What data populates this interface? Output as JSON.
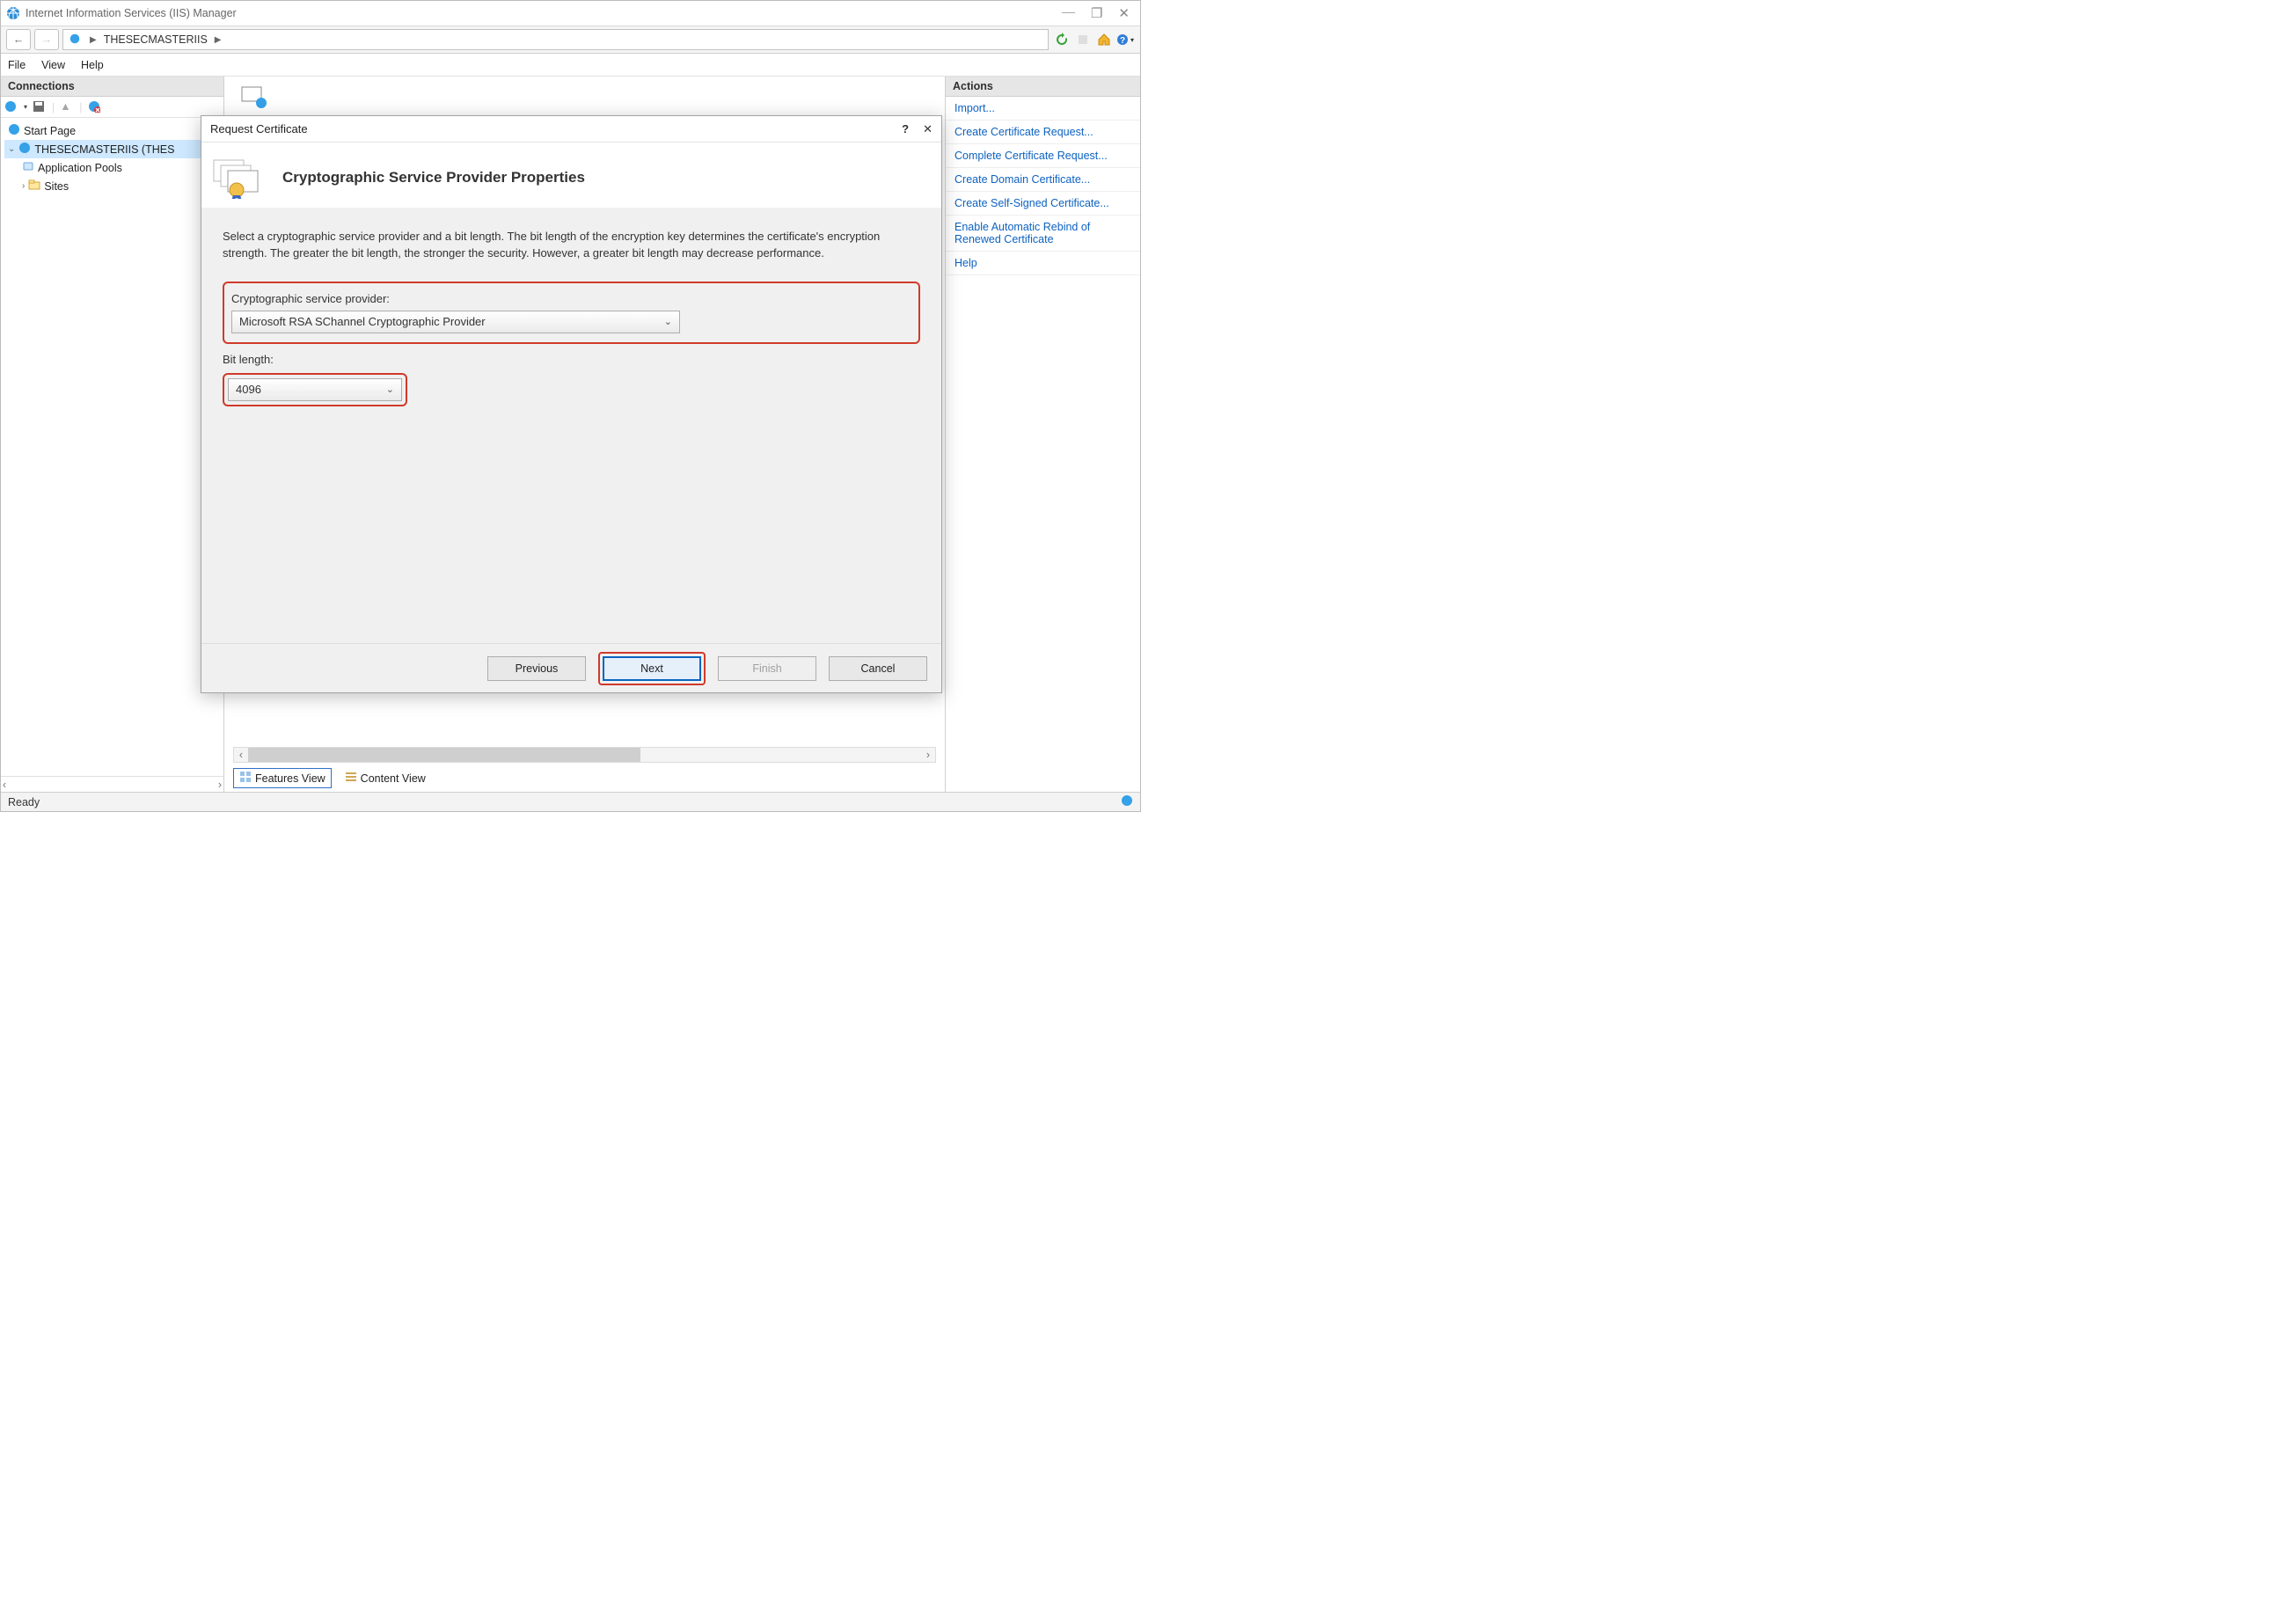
{
  "titlebar": {
    "title": "Internet Information Services (IIS) Manager"
  },
  "nav": {
    "breadcrumb": "THESECMASTERIIS"
  },
  "menubar": {
    "file": "File",
    "view": "View",
    "help": "Help"
  },
  "connections": {
    "title": "Connections",
    "start_page": "Start Page",
    "server": "THESECMASTERIIS (THES",
    "app_pools": "Application Pools",
    "sites": "Sites"
  },
  "actions": {
    "title": "Actions",
    "links": [
      "Import...",
      "Create Certificate Request...",
      "Complete Certificate Request...",
      "Create Domain Certificate...",
      "Create Self-Signed Certificate...",
      "Enable Automatic Rebind of Renewed Certificate",
      "Help"
    ]
  },
  "dialog": {
    "title": "Request Certificate",
    "heading": "Cryptographic Service Provider Properties",
    "description": "Select a cryptographic service provider and a bit length. The bit length of the encryption key determines the certificate's encryption strength. The greater the bit length, the stronger the security. However, a greater bit length may decrease performance.",
    "csp_label": "Cryptographic service provider:",
    "csp_value": "Microsoft RSA SChannel Cryptographic Provider",
    "bit_label": "Bit length:",
    "bit_value": "4096",
    "buttons": {
      "previous": "Previous",
      "next": "Next",
      "finish": "Finish",
      "cancel": "Cancel"
    }
  },
  "content_bottom": {
    "features_view": "Features View",
    "content_view": "Content View"
  },
  "statusbar": {
    "text": "Ready"
  }
}
